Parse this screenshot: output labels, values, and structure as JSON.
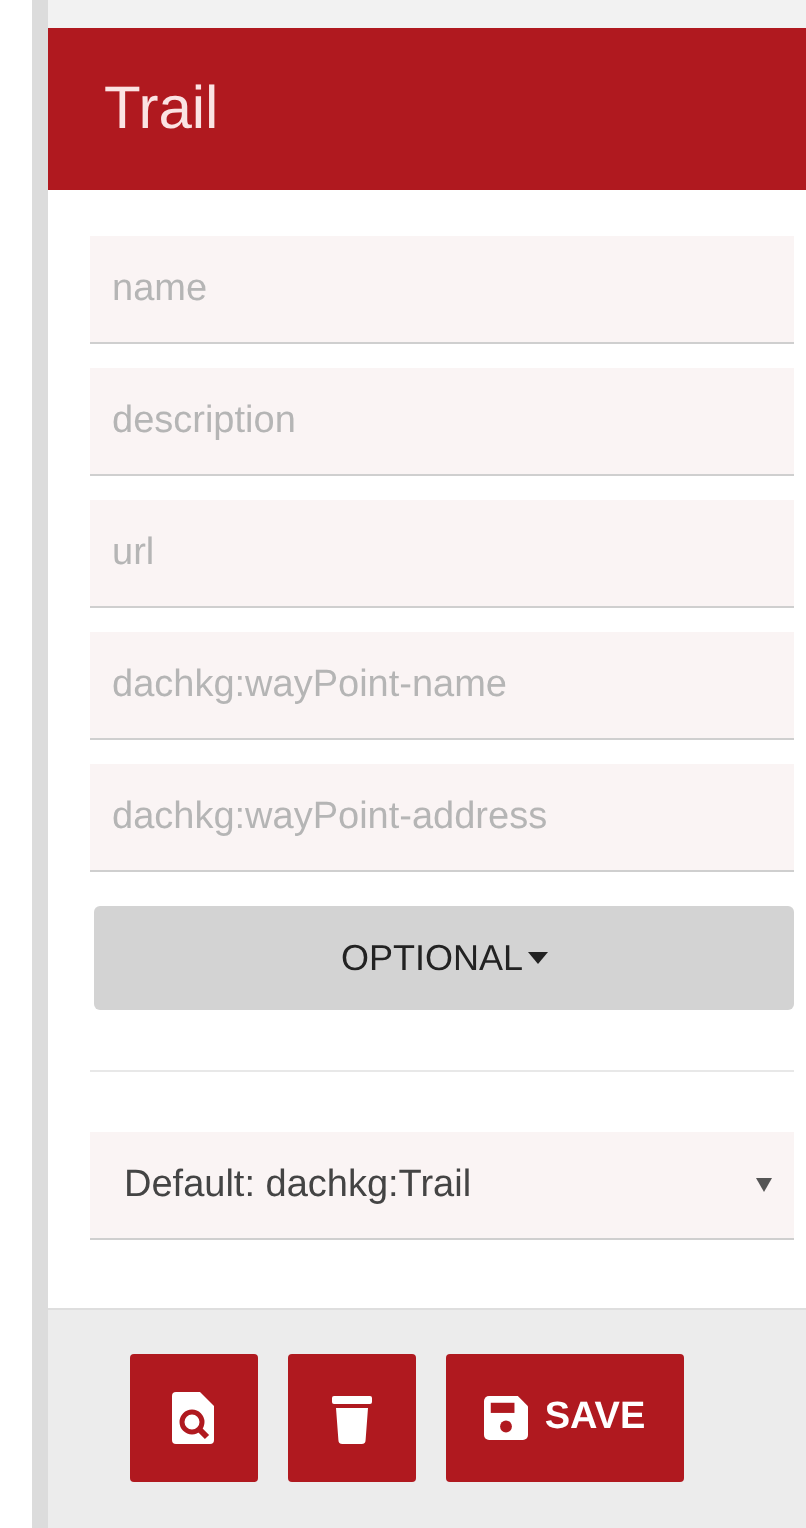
{
  "header": {
    "title": "Trail"
  },
  "fields": [
    {
      "placeholder": "name"
    },
    {
      "placeholder": "description"
    },
    {
      "placeholder": "url"
    },
    {
      "placeholder": "dachkg:wayPoint-name"
    },
    {
      "placeholder": "dachkg:wayPoint-address"
    }
  ],
  "optional_button": {
    "label": "OPTIONAL"
  },
  "type_select": {
    "value": "Default: dachkg:Trail"
  },
  "actions": [
    {
      "kind": "preview"
    },
    {
      "kind": "delete"
    },
    {
      "kind": "save",
      "label": "SAVE"
    }
  ]
}
